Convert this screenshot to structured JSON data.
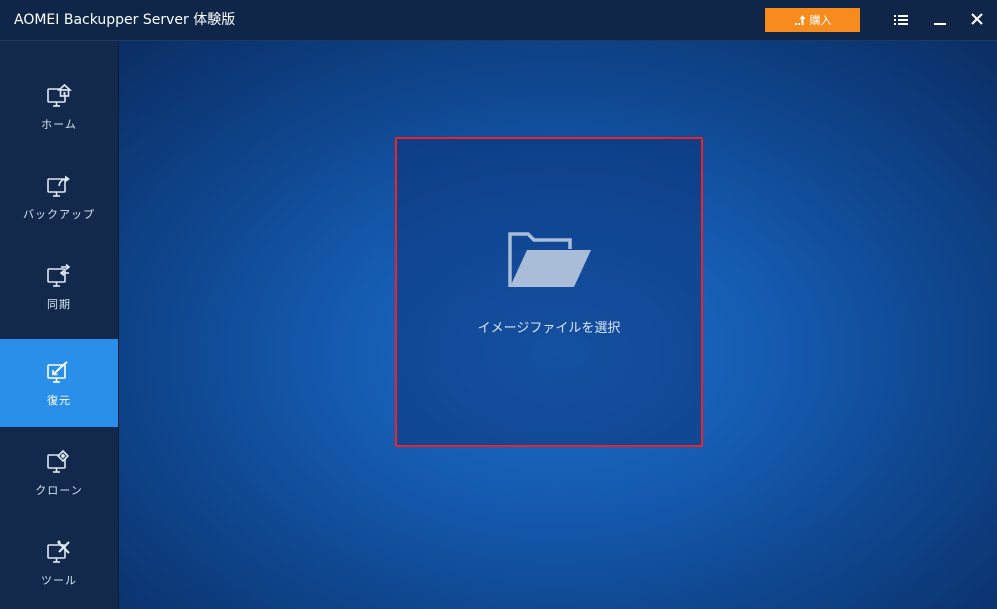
{
  "window": {
    "title": "AOMEI Backupper  Server 体験版",
    "buy_label": "購入",
    "menu_icon": "menu-list-icon",
    "minimize_icon": "minimize-icon",
    "close_icon": "close-icon"
  },
  "sidebar": {
    "items": [
      {
        "label": "ホーム",
        "icon": "home-monitor-icon",
        "active": false
      },
      {
        "label": "バックアップ",
        "icon": "backup-monitor-icon",
        "active": false
      },
      {
        "label": "同期",
        "icon": "sync-monitor-icon",
        "active": false
      },
      {
        "label": "復元",
        "icon": "restore-monitor-icon",
        "active": true
      },
      {
        "label": "クローン",
        "icon": "clone-monitor-icon",
        "active": false
      },
      {
        "label": "ツール",
        "icon": "tools-monitor-icon",
        "active": false
      }
    ]
  },
  "main": {
    "select_image_label": "イメージファイルを選択",
    "select_icon": "folder-open-icon"
  },
  "colors": {
    "accent_active": "#2a8fe8",
    "buy_button": "#f78b1e",
    "highlight_border": "#e8232a"
  }
}
